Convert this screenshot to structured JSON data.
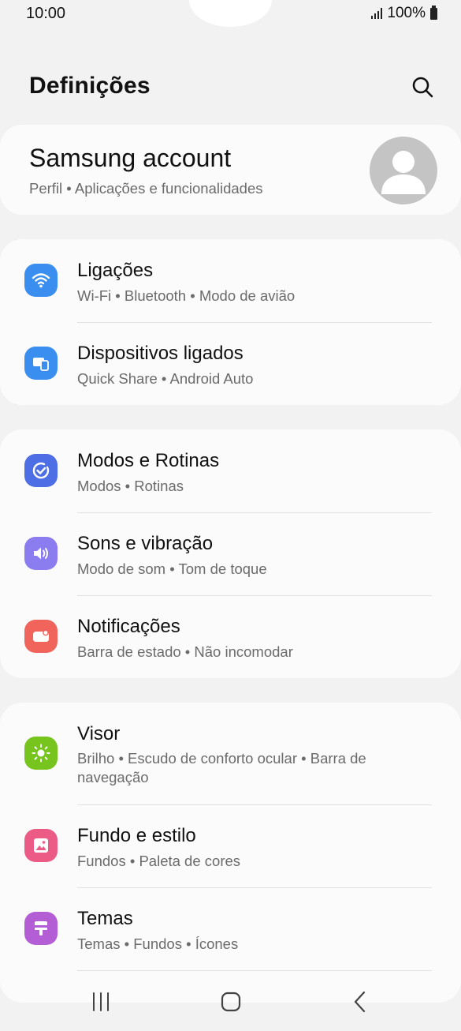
{
  "status_bar": {
    "time": "10:00",
    "battery_text": "100%"
  },
  "header": {
    "title": "Definições"
  },
  "account": {
    "title": "Samsung account",
    "subtitle": "Perfil  •  Aplicações e funcionalidades"
  },
  "groups": [
    {
      "items": [
        {
          "title": "Ligações",
          "subtitle": "Wi-Fi  •  Bluetooth  •  Modo de avião",
          "icon": "wifi-icon",
          "color": "#3a8ef0"
        },
        {
          "title": "Dispositivos ligados",
          "subtitle": "Quick Share  •  Android Auto",
          "icon": "connected-devices-icon",
          "color": "#3a8ef0"
        }
      ]
    },
    {
      "items": [
        {
          "title": "Modos e Rotinas",
          "subtitle": "Modos  •  Rotinas",
          "icon": "routines-icon",
          "color": "#4e6ee6"
        },
        {
          "title": "Sons e vibração",
          "subtitle": "Modo de som  •  Tom de toque",
          "icon": "speaker-icon",
          "color": "#8b7cf0"
        },
        {
          "title": "Notificações",
          "subtitle": "Barra de estado  •  Não incomodar",
          "icon": "notifications-icon",
          "color": "#f0645b"
        }
      ]
    },
    {
      "items": [
        {
          "title": "Visor",
          "subtitle": "Brilho  •  Escudo de conforto ocular  •  Barra de navegação",
          "icon": "brightness-icon",
          "color": "#76c41d"
        },
        {
          "title": "Fundo e estilo",
          "subtitle": "Fundos  •  Paleta de cores",
          "icon": "wallpaper-icon",
          "color": "#ec5a86"
        },
        {
          "title": "Temas",
          "subtitle": "Temas  •  Fundos  •  Ícones",
          "icon": "themes-icon",
          "color": "#b45ed6"
        }
      ]
    }
  ]
}
